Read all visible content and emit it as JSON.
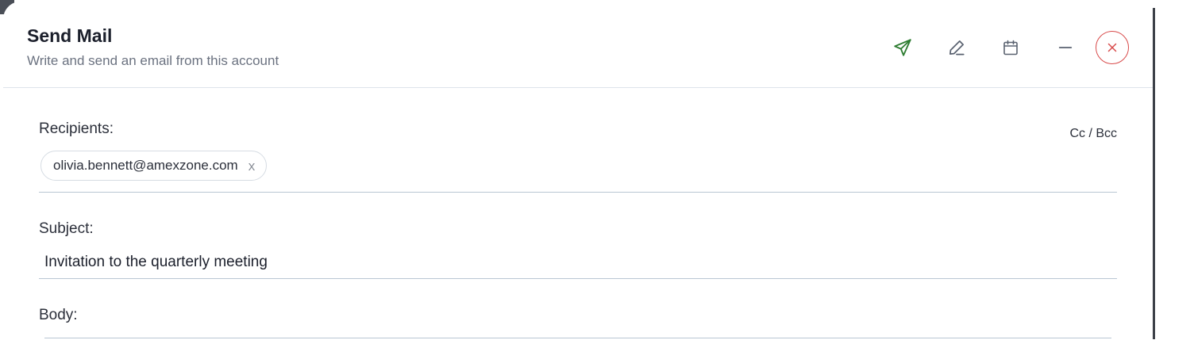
{
  "header": {
    "title": "Send Mail",
    "subtitle": "Write and send an email from this account",
    "actions": [
      {
        "name": "send-icon",
        "color": "#2e7d32"
      },
      {
        "name": "pen-icon",
        "color": "#5a6270"
      },
      {
        "name": "calendar-icon",
        "color": "#5a6270"
      },
      {
        "name": "minimize-icon",
        "color": "#5a6270"
      },
      {
        "name": "close-icon",
        "color": "#d84a4a"
      }
    ]
  },
  "recipients": {
    "label": "Recipients:",
    "cc_bcc_label": "Cc / Bcc",
    "chips": [
      {
        "email": "olivia.bennett@amexzone.com",
        "remove_label": "x"
      }
    ]
  },
  "subject": {
    "label": "Subject:",
    "value": "Invitation to the quarterly meeting"
  },
  "body": {
    "label": "Body:"
  }
}
